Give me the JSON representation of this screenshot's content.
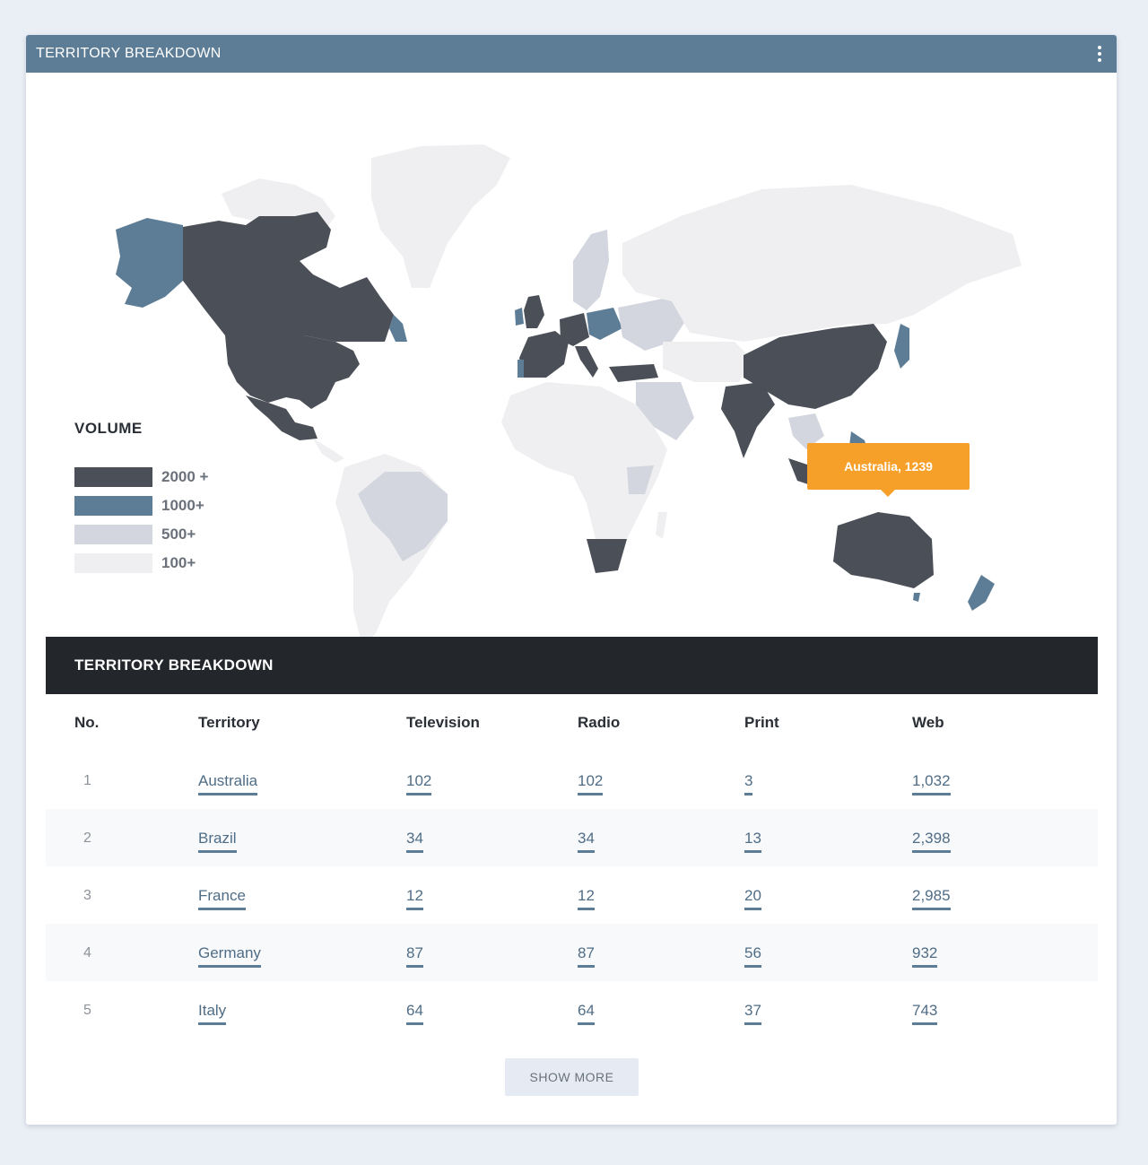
{
  "panel": {
    "title": "TERRITORY BREAKDOWN",
    "menu_icon": "kebab-menu-icon"
  },
  "legend": {
    "title": "VOLUME",
    "items": [
      {
        "label": "2000 +",
        "color": "#4b4f57"
      },
      {
        "label": "1000+",
        "color": "#5d7d96"
      },
      {
        "label": "500+",
        "color": "#d3d6de"
      },
      {
        "label": "100+",
        "color": "#efeff1"
      }
    ]
  },
  "tooltip": {
    "text": "Australia, 1239",
    "color": "#f6a02a"
  },
  "table": {
    "title": "TERRITORY BREAKDOWN",
    "columns": [
      "No.",
      "Territory",
      "Television",
      "Radio",
      "Print",
      "Web"
    ],
    "rows": [
      {
        "no": "1",
        "territory": "Australia",
        "television": "102",
        "radio": "102",
        "print": "3",
        "web": "1,032"
      },
      {
        "no": "2",
        "territory": "Brazil",
        "television": "34",
        "radio": "34",
        "print": "13",
        "web": "2,398"
      },
      {
        "no": "3",
        "territory": "France",
        "television": "12",
        "radio": "12",
        "print": "20",
        "web": "2,985"
      },
      {
        "no": "4",
        "territory": "Germany",
        "television": "87",
        "radio": "87",
        "print": "56",
        "web": "932"
      },
      {
        "no": "5",
        "territory": "Italy",
        "television": "64",
        "radio": "64",
        "print": "37",
        "web": "743"
      }
    ]
  },
  "show_more_label": "SHOW MORE"
}
